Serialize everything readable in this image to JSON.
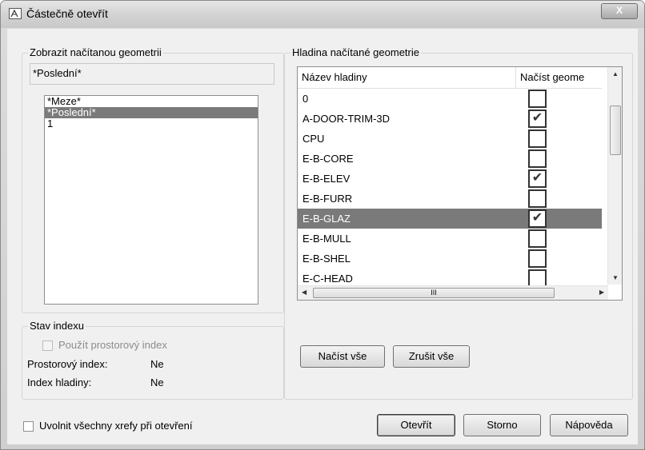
{
  "window": {
    "title": "Částečně otevřít",
    "close_label": "X"
  },
  "view_group": {
    "legend": "Zobrazit načítanou geometrii",
    "current_value": "*Poslední*",
    "items": [
      {
        "label": "*Meze*",
        "selected": false
      },
      {
        "label": "*Poslední*",
        "selected": true
      },
      {
        "label": "1",
        "selected": false
      }
    ]
  },
  "index_group": {
    "legend": "Stav indexu",
    "use_spatial_index_label": "Použít prostorový index",
    "spatial_index_label": "Prostorový index:",
    "spatial_index_value": "Ne",
    "layer_index_label": "Index hladiny:",
    "layer_index_value": "Ne"
  },
  "layer_group": {
    "legend": "Hladina načítané geometrie",
    "columns": [
      "Název hladiny",
      "Načíst geome"
    ],
    "rows": [
      {
        "name": "0",
        "checked": false,
        "selected": false
      },
      {
        "name": "A-DOOR-TRIM-3D",
        "checked": true,
        "selected": false
      },
      {
        "name": "CPU",
        "checked": false,
        "selected": false
      },
      {
        "name": "E-B-CORE",
        "checked": false,
        "selected": false
      },
      {
        "name": "E-B-ELEV",
        "checked": true,
        "selected": false
      },
      {
        "name": "E-B-FURR",
        "checked": false,
        "selected": false
      },
      {
        "name": "E-B-GLAZ",
        "checked": true,
        "selected": true
      },
      {
        "name": "E-B-MULL",
        "checked": false,
        "selected": false
      },
      {
        "name": "E-B-SHEL",
        "checked": false,
        "selected": false
      },
      {
        "name": "E-C-HEAD",
        "checked": false,
        "selected": false
      }
    ],
    "load_all_label": "Načíst vše",
    "clear_all_label": "Zrušit vše",
    "hscroll_thumb_label": "III"
  },
  "footer": {
    "unload_xrefs_label": "Uvolnit všechny xrefy při otevření",
    "open_label": "Otevřít",
    "cancel_label": "Storno",
    "help_label": "Nápověda"
  },
  "icons": {
    "window_icon": "autocad-drawing-icon",
    "scroll_up": "triangle-up",
    "scroll_down": "triangle-down",
    "scroll_left": "triangle-left",
    "scroll_right": "triangle-right"
  },
  "colors": {
    "selection": "#7a7a7a",
    "dialog_bg": "#f0f0f0"
  }
}
